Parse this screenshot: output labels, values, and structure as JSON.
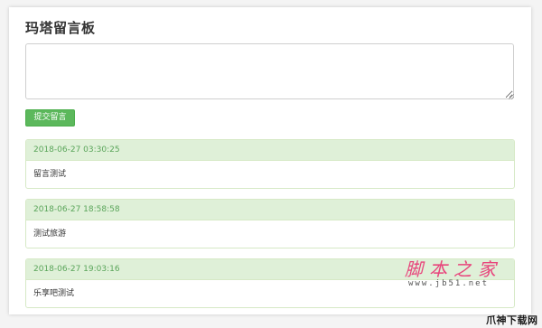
{
  "page": {
    "title": "玛塔留言板"
  },
  "form": {
    "textarea_value": "",
    "submit_label": "提交留言"
  },
  "messages": [
    {
      "time": "2018-06-27 03:30:25",
      "text": "留言测试"
    },
    {
      "time": "2018-06-27 18:58:58",
      "text": "测试旅游"
    },
    {
      "time": "2018-06-27 19:03:16",
      "text": "乐享吧测试"
    }
  ],
  "watermark": {
    "cn": "脚本之家",
    "url": "www.jb51.net"
  },
  "corner_mark": "爪神下载网",
  "colors": {
    "accent": "#5cb85c",
    "panel_head": "#dff0d8",
    "time_text": "#5aa55a",
    "watermark": "#e8457c"
  }
}
